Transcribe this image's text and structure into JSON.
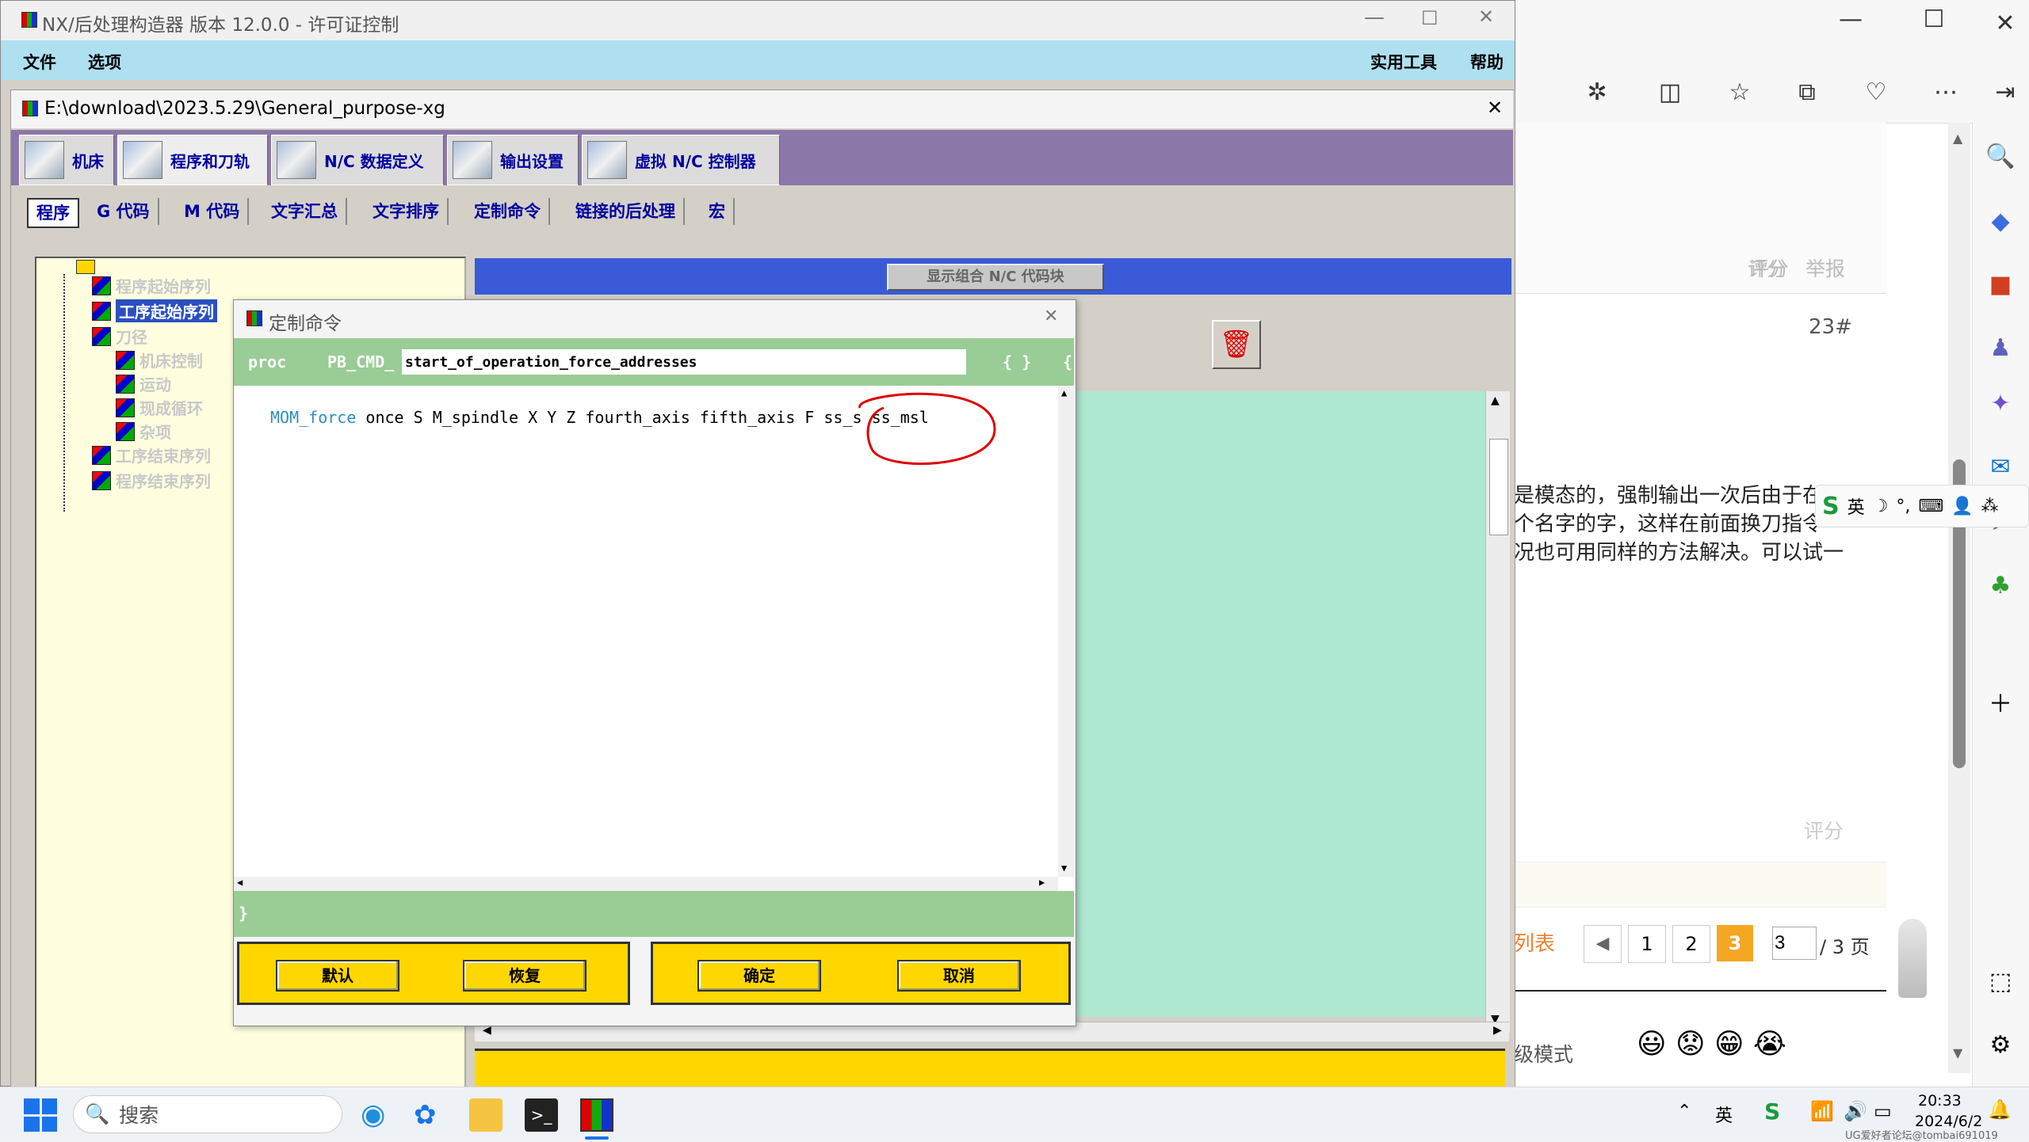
{
  "nx": {
    "title": "NX/后处理构造器 版本 12.0.0 - 许可证控制",
    "menu": {
      "file": "文件",
      "options": "选项",
      "utilities": "实用工具",
      "help": "帮助"
    }
  },
  "sub": {
    "title": "E:\\download\\2023.5.29\\General_purpose-xg",
    "tabs": [
      "机床",
      "程序和刀轨",
      "N/C 数据定义",
      "输出设置",
      "虚拟 N/C 控制器"
    ],
    "subtabs": [
      "程序",
      "G 代码",
      "M 代码",
      "文字汇总",
      "文字排序",
      "定制命令",
      "链接的后处理",
      "宏"
    ],
    "display_blocks": "显示组合 N/C 代码块"
  },
  "tree": {
    "root": "",
    "items": [
      "程序起始序列",
      "工序起始序列",
      "刀径",
      "机床控制",
      "运动",
      "现成循环",
      "杂项",
      "工序结束序列",
      "程序结束序列"
    ]
  },
  "dialog": {
    "title": "定制命令",
    "proc_kw": "proc",
    "prefix": "PB_CMD_",
    "name_value": "start_of_operation_force_addresses",
    "braces": "{ }",
    "brace2": "{",
    "code_cmd": "MOM_force",
    "code_args": "once S M_spindle X Y Z fourth_axis fifth_axis F ss_s ss_msl",
    "close_brace": "}",
    "buttons": {
      "default": "默认",
      "restore": "恢复",
      "ok": "确定",
      "cancel": "取消"
    }
  },
  "browser": {
    "rate": "评分",
    "report": "举报",
    "floor": "23#",
    "post_lines": [
      "是模态的，强制输出一次后由于在置",
      "个名字的字，这样在前面换刀指令",
      "况也可用同样的方法解决。可以试一"
    ],
    "rate2": "评分",
    "list_btn": "列表",
    "pages": [
      "1",
      "2",
      "3"
    ],
    "page_input": "3",
    "page_total": "/ 3 页",
    "mode": "级模式"
  },
  "ime": {
    "lang": "英"
  },
  "taskbar": {
    "search": "搜索",
    "time": "20:33",
    "date": "2024/6/2",
    "ime_lang": "英",
    "watermark": "UG爱好者论坛@tombai691019"
  },
  "colors": {
    "accent_purple": "#8b78a9",
    "blue_bar": "#3a5ad8",
    "teal": "#aee8d0",
    "green": "#9acc96",
    "yellow": "#ffd700",
    "page_active": "#f5a623"
  }
}
